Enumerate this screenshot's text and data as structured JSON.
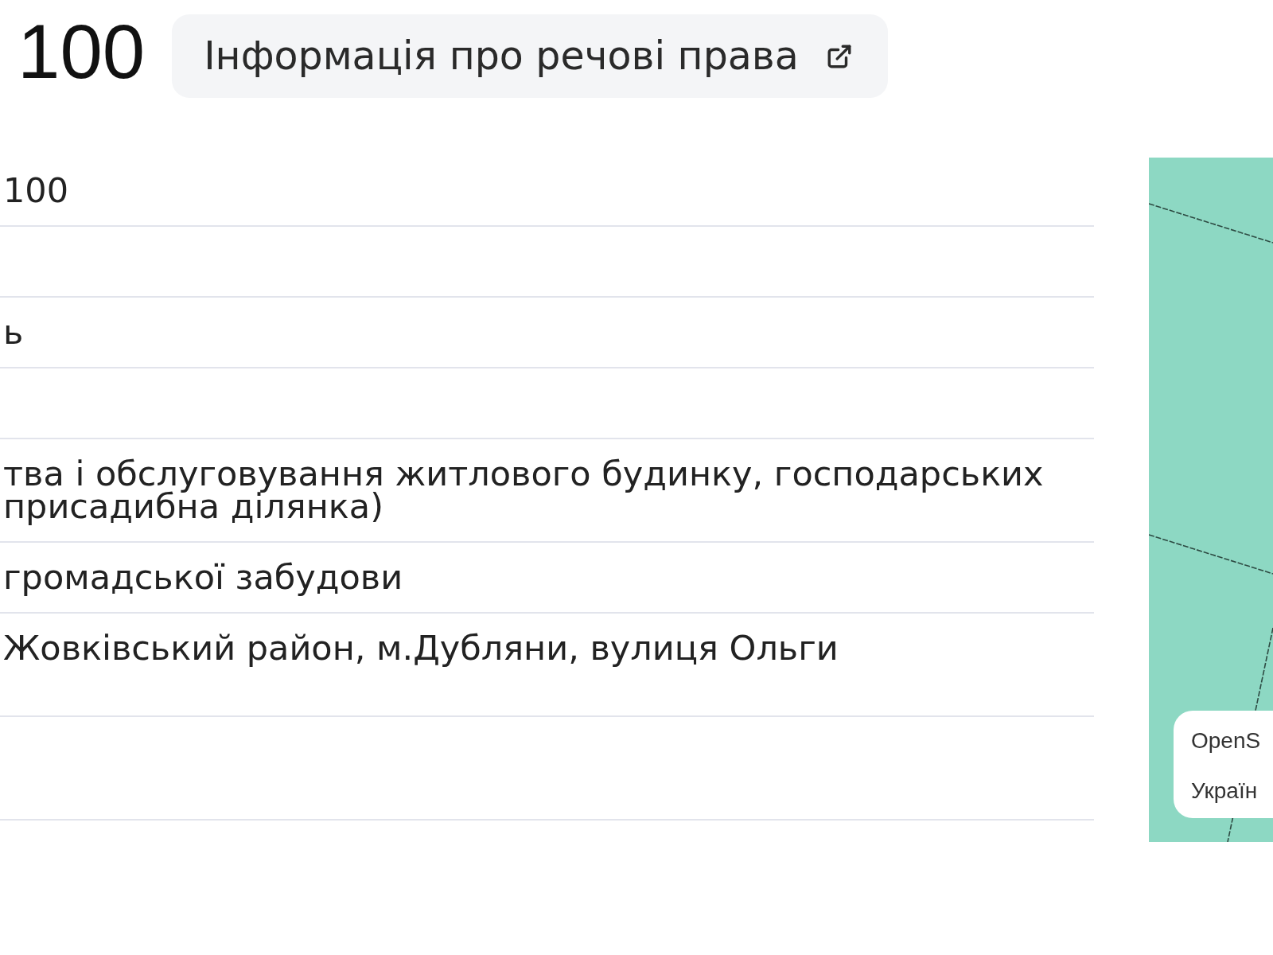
{
  "header": {
    "title": "100",
    "rights_link": {
      "label": "Інформація про речові права"
    }
  },
  "table": {
    "rows": [
      {
        "kind": "short",
        "lines": [
          "100"
        ]
      },
      {
        "kind": "short"
      },
      {
        "kind": "short",
        "lines": [
          "ь"
        ]
      },
      {
        "kind": "short"
      },
      {
        "kind": "tall",
        "lines": [
          "тва і обслуговування житлового будинку, господарських",
          "присадибна ділянка)"
        ]
      },
      {
        "kind": "short",
        "lines": [
          "громадської забудови"
        ]
      },
      {
        "kind": "tall",
        "lines": [
          "Жовківський район, м.Дубляни, вулиця Ольги"
        ]
      },
      {
        "kind": "tall"
      }
    ]
  },
  "map": {
    "attribution": [
      "OpenS",
      "Україн"
    ]
  }
}
